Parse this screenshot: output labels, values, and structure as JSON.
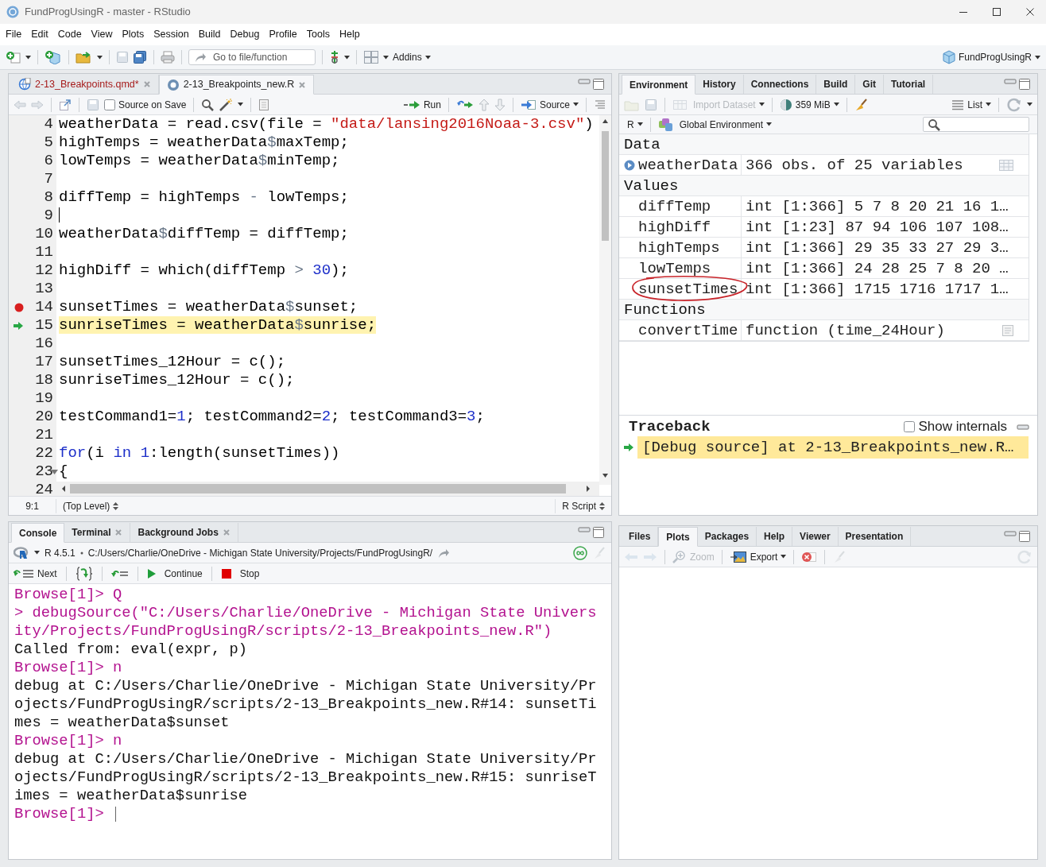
{
  "window": {
    "title": "FundProgUsingR - master - RStudio"
  },
  "menu": [
    "File",
    "Edit",
    "Code",
    "View",
    "Plots",
    "Session",
    "Build",
    "Debug",
    "Profile",
    "Tools",
    "Help"
  ],
  "toolbar": {
    "goto_placeholder": "Go to file/function",
    "addins": "Addins",
    "project": "FundProgUsingR"
  },
  "editor": {
    "tabs": [
      {
        "label": "2-13_Breakpoints.qmd*",
        "selected": false,
        "modified": true
      },
      {
        "label": "2-13_Breakpoints_new.R",
        "selected": true,
        "modified": false
      }
    ],
    "source_on_save": {
      "label": "Source on Save",
      "checked": false
    },
    "run": "Run",
    "source": "Source",
    "lines": [
      {
        "number": "4",
        "breakpoint": false,
        "current": false,
        "cursor": false,
        "fold": false,
        "tokens": [
          {
            "kind": "text",
            "text": "weatherData = read.csv(file = "
          },
          {
            "kind": "string",
            "text": "\"data/lansing2016Noaa-3.csv\""
          },
          {
            "kind": "text",
            "text": ")"
          }
        ]
      },
      {
        "number": "5",
        "breakpoint": false,
        "current": false,
        "cursor": false,
        "fold": false,
        "tokens": [
          {
            "kind": "text",
            "text": "highTemps = weatherData"
          },
          {
            "kind": "operator",
            "text": "$"
          },
          {
            "kind": "text",
            "text": "maxTemp;"
          }
        ]
      },
      {
        "number": "6",
        "breakpoint": false,
        "current": false,
        "cursor": false,
        "fold": false,
        "tokens": [
          {
            "kind": "text",
            "text": "lowTemps = weatherData"
          },
          {
            "kind": "operator",
            "text": "$"
          },
          {
            "kind": "text",
            "text": "minTemp;"
          }
        ]
      },
      {
        "number": "7",
        "breakpoint": false,
        "current": false,
        "cursor": false,
        "fold": false
      },
      {
        "number": "8",
        "breakpoint": false,
        "current": false,
        "cursor": false,
        "fold": false,
        "tokens": [
          {
            "kind": "text",
            "text": "diffTemp = highTemps "
          },
          {
            "kind": "operator",
            "text": "-"
          },
          {
            "kind": "text",
            "text": " lowTemps;"
          }
        ]
      },
      {
        "number": "9",
        "breakpoint": false,
        "current": false,
        "cursor": true,
        "fold": false
      },
      {
        "number": "10",
        "breakpoint": false,
        "current": false,
        "cursor": false,
        "fold": false,
        "tokens": [
          {
            "kind": "text",
            "text": "weatherData"
          },
          {
            "kind": "operator",
            "text": "$"
          },
          {
            "kind": "text",
            "text": "diffTemp = diffTemp;"
          }
        ]
      },
      {
        "number": "11",
        "breakpoint": false,
        "current": false,
        "cursor": false,
        "fold": false
      },
      {
        "number": "12",
        "breakpoint": false,
        "current": false,
        "cursor": false,
        "fold": false,
        "tokens": [
          {
            "kind": "text",
            "text": "highDiff = which(diffTemp "
          },
          {
            "kind": "operator",
            "text": "> "
          },
          {
            "kind": "number",
            "text": "30"
          },
          {
            "kind": "text",
            "text": ");"
          }
        ]
      },
      {
        "number": "13",
        "breakpoint": false,
        "current": false,
        "cursor": false,
        "fold": false
      },
      {
        "number": "14",
        "breakpoint": true,
        "current": false,
        "cursor": false,
        "fold": false,
        "tokens": [
          {
            "kind": "text",
            "text": "sunsetTimes = weatherData"
          },
          {
            "kind": "operator",
            "text": "$"
          },
          {
            "kind": "text",
            "text": "sunset;"
          }
        ]
      },
      {
        "number": "15",
        "breakpoint": false,
        "current": true,
        "cursor": false,
        "fold": false,
        "tokens": [
          {
            "kind": "text",
            "text": "sunriseTimes = weatherData"
          },
          {
            "kind": "operator",
            "text": "$"
          },
          {
            "kind": "text",
            "text": "sunrise;"
          }
        ]
      },
      {
        "number": "16",
        "breakpoint": false,
        "current": false,
        "cursor": false,
        "fold": false
      },
      {
        "number": "17",
        "breakpoint": false,
        "current": false,
        "cursor": false,
        "fold": false,
        "tokens": [
          {
            "kind": "text",
            "text": "sunsetTimes_12Hour = c();"
          }
        ]
      },
      {
        "number": "18",
        "breakpoint": false,
        "current": false,
        "cursor": false,
        "fold": false,
        "tokens": [
          {
            "kind": "text",
            "text": "sunriseTimes_12Hour = c();"
          }
        ]
      },
      {
        "number": "19",
        "breakpoint": false,
        "current": false,
        "cursor": false,
        "fold": false
      },
      {
        "number": "20",
        "breakpoint": false,
        "current": false,
        "cursor": false,
        "fold": false,
        "tokens": [
          {
            "kind": "text",
            "text": "testCommand1="
          },
          {
            "kind": "number",
            "text": "1"
          },
          {
            "kind": "text",
            "text": "; testCommand2="
          },
          {
            "kind": "number",
            "text": "2"
          },
          {
            "kind": "text",
            "text": "; testCommand3="
          },
          {
            "kind": "number",
            "text": "3"
          },
          {
            "kind": "text",
            "text": ";"
          }
        ]
      },
      {
        "number": "21",
        "breakpoint": false,
        "current": false,
        "cursor": false,
        "fold": false
      },
      {
        "number": "22",
        "breakpoint": false,
        "current": false,
        "cursor": false,
        "fold": false,
        "tokens": [
          {
            "kind": "keyword",
            "text": "for"
          },
          {
            "kind": "text",
            "text": "(i "
          },
          {
            "kind": "keyword",
            "text": "in "
          },
          {
            "kind": "number",
            "text": "1"
          },
          {
            "kind": "text",
            "text": ":length(sunsetTimes))"
          }
        ]
      },
      {
        "number": "23",
        "breakpoint": false,
        "current": false,
        "cursor": false,
        "fold": true,
        "tokens": [
          {
            "kind": "text",
            "text": "{"
          }
        ]
      },
      {
        "number": "24",
        "breakpoint": false,
        "current": false,
        "fold": false
      }
    ],
    "position": "9:1",
    "scope": "(Top Level)",
    "filetype": "R Script"
  },
  "console": {
    "tabs": [
      {
        "label": "Console",
        "selected": true,
        "closable": false
      },
      {
        "label": "Terminal",
        "selected": false,
        "closable": true
      },
      {
        "label": "Background Jobs",
        "selected": false,
        "closable": true
      }
    ],
    "version": "R 4.5.1",
    "path": "C:/Users/Charlie/OneDrive - Michigan State University/Projects/FundProgUsingR/",
    "next": "Next",
    "continue": "Continue",
    "stop": "Stop",
    "lines": [
      {
        "kind": "prompt",
        "text": "Browse[1]> Q"
      },
      {
        "kind": "prompt",
        "text": "> debugSource(\"C:/Users/Charlie/OneDrive - Michigan State University/Projects/FundProgUsingR/scripts/2-13_Breakpoints_new.R\")"
      },
      {
        "kind": "output",
        "text": "Called from: eval(expr, p)"
      },
      {
        "kind": "prompt",
        "text": "Browse[1]> n"
      },
      {
        "kind": "output",
        "text": "debug at C:/Users/Charlie/OneDrive - Michigan State University/Projects/FundProgUsingR/scripts/2-13_Breakpoints_new.R#14: sunsetTimes = weatherData$sunset"
      },
      {
        "kind": "prompt",
        "text": "Browse[1]> n"
      },
      {
        "kind": "output",
        "text": "debug at C:/Users/Charlie/OneDrive - Michigan State University/Projects/FundProgUsingR/scripts/2-13_Breakpoints_new.R#15: sunriseTimes = weatherData$sunrise"
      },
      {
        "kind": "input",
        "text": "Browse[1]>"
      }
    ]
  },
  "environment": {
    "tabs": [
      {
        "label": "Environment",
        "selected": true
      },
      {
        "label": "History",
        "selected": false
      },
      {
        "label": "Connections",
        "selected": false
      },
      {
        "label": "Build",
        "selected": false
      },
      {
        "label": "Git",
        "selected": false
      },
      {
        "label": "Tutorial",
        "selected": false
      }
    ],
    "buttons": [
      {
        "label": "Import Dataset",
        "disabled": true
      },
      {
        "label": "359 MiB",
        "disabled": false
      },
      {
        "label": "List",
        "disabled": false
      }
    ],
    "language": "R",
    "scope": "Global Environment",
    "sections": [
      {
        "title": "Data",
        "rows": [
          {
            "name": "weatherData",
            "value": "366 obs. of 25 variables",
            "kind": "data",
            "circled": false
          }
        ]
      },
      {
        "title": "Values",
        "rows": [
          {
            "name": "diffTemp",
            "value": "int [1:366] 5 7 8 20 21 16 1…",
            "kind": "value",
            "circled": false
          },
          {
            "name": "highDiff",
            "value": "int [1:23] 87 94 106 107 108…",
            "kind": "value",
            "circled": false
          },
          {
            "name": "highTemps",
            "value": "int [1:366] 29 35 33 27 29 3…",
            "kind": "value",
            "circled": false
          },
          {
            "name": "lowTemps",
            "value": "int [1:366] 24 28 25 7 8 20 …",
            "kind": "value",
            "circled": false
          },
          {
            "name": "sunsetTimes",
            "value": "int [1:366] 1715 1716 1717 1…",
            "kind": "value",
            "circled": true
          }
        ]
      },
      {
        "title": "Functions",
        "rows": [
          {
            "name": "convertTime",
            "value": "function (time_24Hour)",
            "kind": "function",
            "circled": false
          }
        ]
      }
    ]
  },
  "traceback": {
    "title": "Traceback",
    "show_internals": {
      "label": "Show internals",
      "checked": false
    },
    "frames": [
      {
        "text": "[Debug source] at 2-13_Breakpoints_new.R…",
        "selected": true
      }
    ]
  },
  "files": {
    "tabs": [
      {
        "label": "Files",
        "selected": false
      },
      {
        "label": "Plots",
        "selected": true
      },
      {
        "label": "Packages",
        "selected": false
      },
      {
        "label": "Help",
        "selected": false
      },
      {
        "label": "Viewer",
        "selected": false
      },
      {
        "label": "Presentation",
        "selected": false
      }
    ],
    "buttons": [
      {
        "label": "Zoom",
        "disabled": true
      },
      {
        "label": "Export",
        "disabled": false
      }
    ]
  }
}
